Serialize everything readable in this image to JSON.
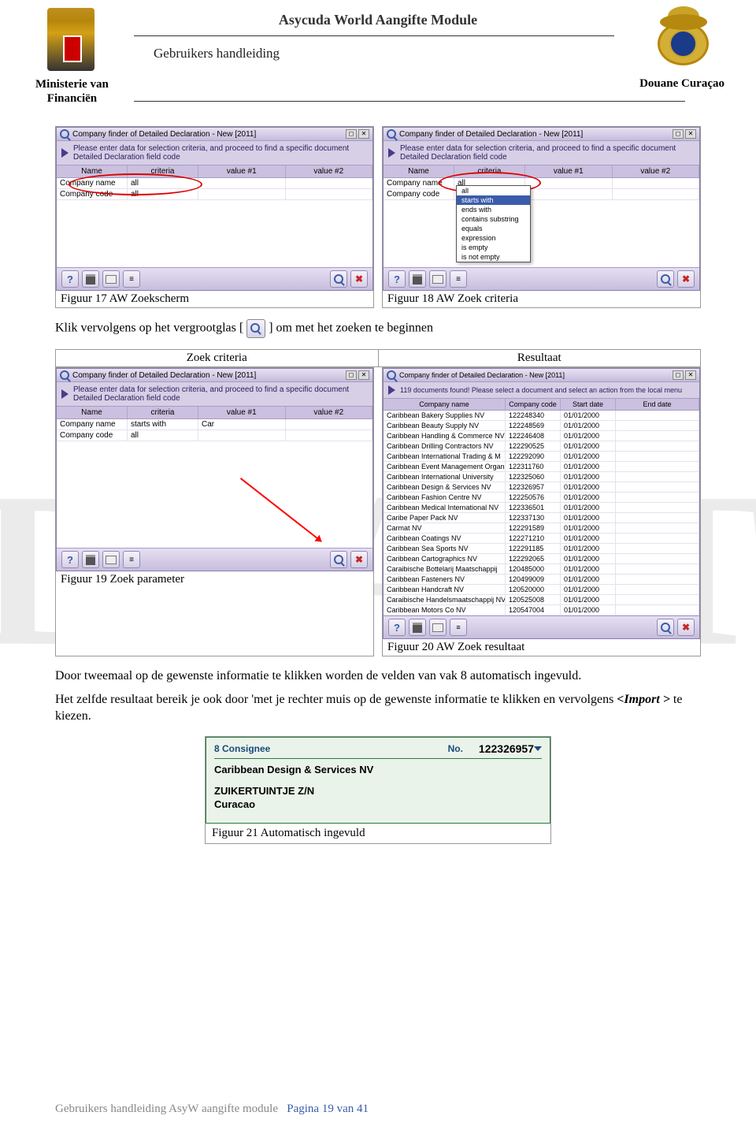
{
  "header": {
    "title": "Asycuda World Aangifte Module",
    "subtitle": "Gebruikers handleiding",
    "ministry_line1": "Ministerie van",
    "ministry_line2": "Financiën",
    "douane": "Douane Curaçao"
  },
  "watermark": "DRAFT",
  "fig17": {
    "window_title": "Company finder of Detailed Declaration - New [2011]",
    "instruction": "Please enter data for selection criteria, and proceed to find a specific document Detailed Declaration field code",
    "cols": {
      "name": "Name",
      "criteria": "criteria",
      "v1": "value #1",
      "v2": "value #2"
    },
    "rows": [
      {
        "name": "Company name",
        "criteria": "all",
        "v1": "",
        "v2": ""
      },
      {
        "name": "Company code",
        "criteria": "all",
        "v1": "",
        "v2": ""
      }
    ],
    "caption": "Figuur 17    AW Zoekscherm"
  },
  "fig18": {
    "window_title": "Company finder of Detailed Declaration - New [2011]",
    "instruction": "Please enter data for selection criteria, and proceed to find a specific document Detailed Declaration field code",
    "cols": {
      "name": "Name",
      "criteria": "criteria",
      "v1": "value #1",
      "v2": "value #2"
    },
    "rows": [
      {
        "name": "Company name",
        "criteria": "all",
        "v1": "",
        "v2": ""
      },
      {
        "name": "Company code",
        "criteria": "all",
        "v1": "",
        "v2": ""
      }
    ],
    "dropdown": [
      "all",
      "starts with",
      "ends with",
      "contains substring",
      "equals",
      "expression",
      "is empty",
      "is not empty"
    ],
    "caption": "Figuur 18    AW Zoek criteria"
  },
  "midtext_before": "Klik vervolgens op het vergrootglas [",
  "midtext_after": "] om met het zoeken te beginnen",
  "section_headers": {
    "left": "Zoek criteria",
    "right": "Resultaat"
  },
  "fig19": {
    "window_title": "Company finder of Detailed Declaration - New [2011]",
    "instruction": "Please enter data for selection criteria, and proceed to find a specific document Detailed Declaration field code",
    "cols": {
      "name": "Name",
      "criteria": "criteria",
      "v1": "value #1",
      "v2": "value #2"
    },
    "rows": [
      {
        "name": "Company name",
        "criteria": "starts with",
        "v1": "Car",
        "v2": ""
      },
      {
        "name": "Company code",
        "criteria": "all",
        "v1": "",
        "v2": ""
      }
    ],
    "caption": "Figuur 19        Zoek parameter"
  },
  "fig20": {
    "window_title": "Company finder of Detailed Declaration - New [2011]",
    "instruction": "119 documents found! Please select a document and select an action from the local menu",
    "cols": {
      "c1": "Company name",
      "c2": "Company code",
      "c3": "Start date",
      "c4": "End date"
    },
    "rows": [
      {
        "c1": "Caribbean Bakery Supplies NV",
        "c2": "122248340",
        "c3": "01/01/2000",
        "c4": ""
      },
      {
        "c1": "Caribbean Beauty Supply NV",
        "c2": "122248569",
        "c3": "01/01/2000",
        "c4": ""
      },
      {
        "c1": "Caribbean Handling & Commerce NV",
        "c2": "122246408",
        "c3": "01/01/2000",
        "c4": ""
      },
      {
        "c1": "Caribbean Drilling Contractors NV",
        "c2": "122290525",
        "c3": "01/01/2000",
        "c4": ""
      },
      {
        "c1": "Caribbean International Trading & M",
        "c2": "122292090",
        "c3": "01/01/2000",
        "c4": ""
      },
      {
        "c1": "Caribbean Event Management Organisa",
        "c2": "122311760",
        "c3": "01/01/2000",
        "c4": ""
      },
      {
        "c1": "Caribbean International University",
        "c2": "122325060",
        "c3": "01/01/2000",
        "c4": ""
      },
      {
        "c1": "Caribbean Design & Services NV",
        "c2": "122326957",
        "c3": "01/01/2000",
        "c4": ""
      },
      {
        "c1": "Caribbean Fashion Centre NV",
        "c2": "122250576",
        "c3": "01/01/2000",
        "c4": ""
      },
      {
        "c1": "Caribbean Medical International NV",
        "c2": "122336501",
        "c3": "01/01/2000",
        "c4": ""
      },
      {
        "c1": "Caribe Paper Pack NV",
        "c2": "122337130",
        "c3": "01/01/2000",
        "c4": ""
      },
      {
        "c1": "Carmat NV",
        "c2": "122291589",
        "c3": "01/01/2000",
        "c4": ""
      },
      {
        "c1": "Caribbean Coatings NV",
        "c2": "122271210",
        "c3": "01/01/2000",
        "c4": ""
      },
      {
        "c1": "Caribbean Sea Sports NV",
        "c2": "122291185",
        "c3": "01/01/2000",
        "c4": ""
      },
      {
        "c1": "Caribbean Cartographics NV",
        "c2": "122292065",
        "c3": "01/01/2000",
        "c4": ""
      },
      {
        "c1": "Caraibische Bottelarij Maatschappij",
        "c2": "120485000",
        "c3": "01/01/2000",
        "c4": ""
      },
      {
        "c1": "Caribbean Fasteners NV",
        "c2": "120499009",
        "c3": "01/01/2000",
        "c4": ""
      },
      {
        "c1": "Caribbean Handcraft NV",
        "c2": "120520000",
        "c3": "01/01/2000",
        "c4": ""
      },
      {
        "c1": "Caraibische Handelsmaatschappij NV",
        "c2": "120525008",
        "c3": "01/01/2000",
        "c4": ""
      },
      {
        "c1": "Caribbean Motors Co NV",
        "c2": "120547004",
        "c3": "01/01/2000",
        "c4": ""
      }
    ],
    "caption": "Figuur 20        AW Zoek resultaat"
  },
  "para1": "Door tweemaal op de gewenste informatie te klikken worden de velden van vak 8 automatisch ingevuld.",
  "para2_a": "Het zelfde resultaat bereik je ook door 'met je rechter muis op de gewenste informatie te klikken en vervolgens ",
  "para2_b": "<Import >",
  "para2_c": " te kiezen.",
  "fig21": {
    "lbl8": "8 Consignee",
    "no": "No.",
    "code": "122326957",
    "name": "Caribbean Design & Services NV",
    "addr1": "ZUIKERTUINTJE Z/N",
    "addr2": "Curacao",
    "caption": "Figuur 21        Automatisch ingevuld"
  },
  "footer": {
    "text": "Gebruikers handleiding AsyW aangifte module",
    "page": "Pagina 19 van 41"
  }
}
